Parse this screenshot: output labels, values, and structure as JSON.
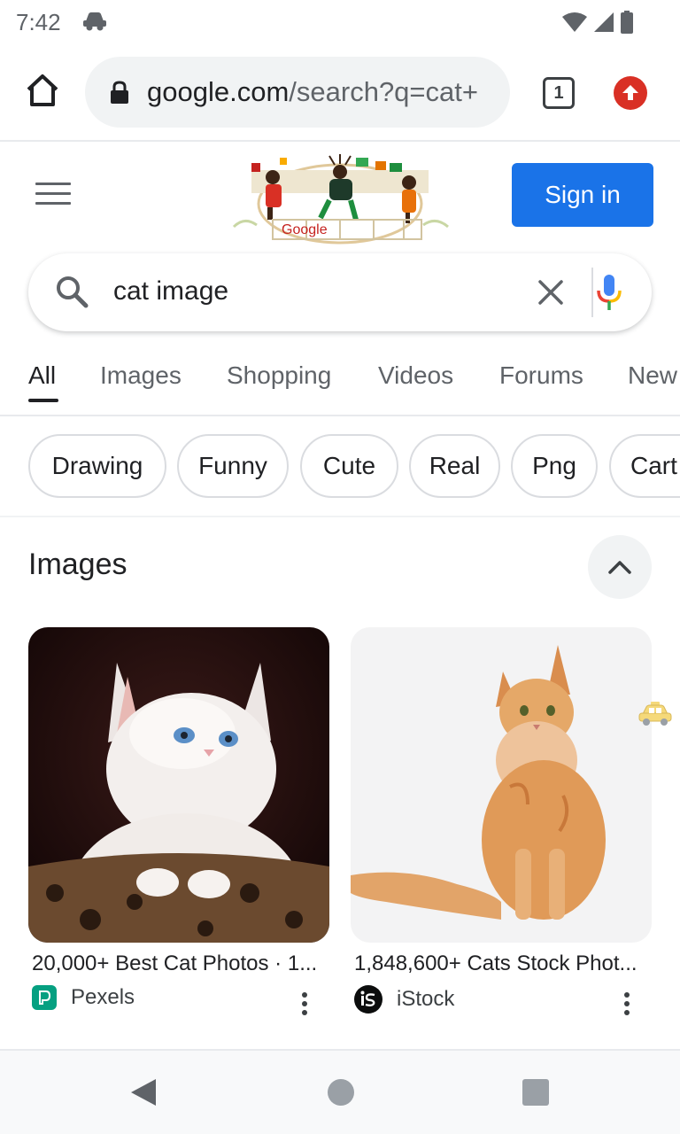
{
  "status_bar": {
    "time": "7:42",
    "icons": [
      "incognito-car-icon",
      "wifi-icon",
      "cellular-signal-icon",
      "battery-icon"
    ]
  },
  "browser": {
    "url_domain": "google.com",
    "url_path": "/search?q=cat+",
    "tab_count": "1",
    "icons": [
      "home-icon",
      "lock-icon",
      "update-arrow-icon"
    ],
    "accent_update_color": "#d93025"
  },
  "header": {
    "signin_label": "Sign in",
    "signin_color": "#1a73e8",
    "doodle_text": "Google"
  },
  "search": {
    "query": "cat image"
  },
  "tabs": [
    {
      "label": "All",
      "active": true
    },
    {
      "label": "Images",
      "active": false
    },
    {
      "label": "Shopping",
      "active": false
    },
    {
      "label": "Videos",
      "active": false
    },
    {
      "label": "Forums",
      "active": false
    },
    {
      "label": "New",
      "active": false
    }
  ],
  "chips": [
    "Drawing",
    "Funny",
    "Cute",
    "Real",
    "Png",
    "Cart"
  ],
  "images_section": {
    "heading": "Images",
    "results": [
      {
        "title": "20,000+ Best Cat Photos · 1...",
        "source": "Pexels",
        "source_icon": "pexels-logo"
      },
      {
        "title": "1,848,600+ Cats Stock Phot...",
        "source": "iStock",
        "source_icon": "istock-logo"
      }
    ]
  },
  "nav_bar": {
    "icons": [
      "back-icon",
      "home-circle-icon",
      "recents-square-icon"
    ]
  }
}
